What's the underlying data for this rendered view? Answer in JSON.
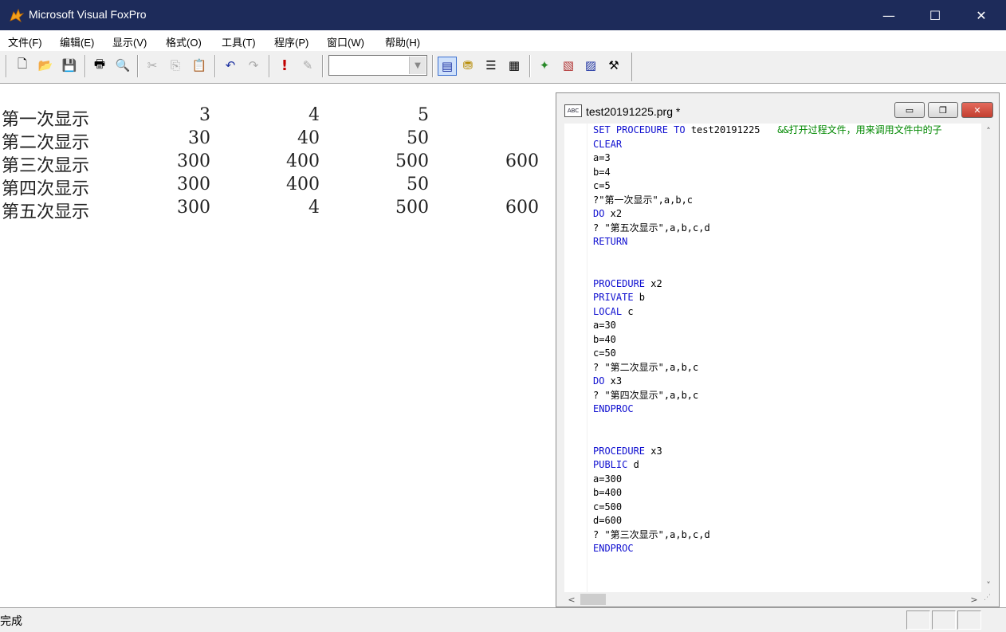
{
  "window": {
    "title": "Microsoft Visual FoxPro",
    "minimize_glyph": "—",
    "maximize_glyph": "☐",
    "close_glyph": "✕"
  },
  "menu": [
    {
      "label": "文件(F)"
    },
    {
      "label": "编辑(E)"
    },
    {
      "label": "显示(V)"
    },
    {
      "label": "格式(O)"
    },
    {
      "label": "工具(T)"
    },
    {
      "label": "程序(P)"
    },
    {
      "label": "窗口(W)"
    },
    {
      "label": "帮助(H)"
    }
  ],
  "toolbar": {
    "buttons": [
      {
        "icon": "new-file-icon",
        "glyph": "🗋",
        "enabled": true
      },
      {
        "icon": "open-folder-icon",
        "glyph": "📂",
        "enabled": true
      },
      {
        "icon": "save-icon",
        "glyph": "💾",
        "enabled": true
      },
      {
        "icon": "print-icon",
        "glyph": "🖶",
        "enabled": true
      },
      {
        "icon": "print-preview-icon",
        "glyph": "🔍",
        "enabled": false
      },
      {
        "icon": "cut-icon",
        "glyph": "✂",
        "enabled": false
      },
      {
        "icon": "copy-icon",
        "glyph": "⎘",
        "enabled": false
      },
      {
        "icon": "paste-icon",
        "glyph": "📋",
        "enabled": true
      },
      {
        "icon": "undo-icon",
        "glyph": "↶",
        "enabled": true
      },
      {
        "icon": "redo-icon",
        "glyph": "↷",
        "enabled": false
      },
      {
        "icon": "run-icon",
        "glyph": "!",
        "enabled": true
      },
      {
        "icon": "modify-form-icon",
        "glyph": "✎",
        "enabled": false
      },
      {
        "icon": "command-window-icon",
        "glyph": "▤",
        "enabled": true
      },
      {
        "icon": "data-session-icon",
        "glyph": "⛃",
        "enabled": true
      },
      {
        "icon": "properties-icon",
        "glyph": "☰",
        "enabled": true
      },
      {
        "icon": "code-window-icon",
        "glyph": "▦",
        "enabled": true
      },
      {
        "icon": "form-wizard-icon",
        "glyph": "✦",
        "enabled": true
      },
      {
        "icon": "autoformat-icon",
        "glyph": "▧",
        "enabled": true
      },
      {
        "icon": "report-designer-icon",
        "glyph": "▨",
        "enabled": true
      },
      {
        "icon": "tools-icon",
        "glyph": "⚒",
        "enabled": true
      }
    ],
    "combo_value": "",
    "combo_arrow": "▼"
  },
  "output": [
    {
      "label": "第一次显示",
      "values": [
        "3",
        "4",
        "5",
        ""
      ]
    },
    {
      "label": "第二次显示",
      "values": [
        "30",
        "40",
        "50",
        ""
      ]
    },
    {
      "label": "第三次显示",
      "values": [
        "300",
        "400",
        "500",
        "600"
      ]
    },
    {
      "label": "第四次显示",
      "values": [
        "300",
        "400",
        "50",
        ""
      ]
    },
    {
      "label": "第五次显示",
      "values": [
        "300",
        "4",
        "500",
        "600"
      ]
    }
  ],
  "editor": {
    "title": "test20191225.prg *",
    "icon_text": "ABC",
    "min_glyph": "▭",
    "max_glyph": "❐",
    "close_glyph": "✕",
    "lines": [
      {
        "kw": "SET PROCEDURE TO",
        "text": " test20191225   ",
        "cm": "&&打开过程文件，用来调用文件中的子"
      },
      {
        "kw": "CLEAR",
        "text": "",
        "cm": ""
      },
      {
        "kw": "",
        "text": "a=3",
        "cm": ""
      },
      {
        "kw": "",
        "text": "b=4",
        "cm": ""
      },
      {
        "kw": "",
        "text": "c=5",
        "cm": ""
      },
      {
        "kw": "",
        "text": "?\"第一次显示\",a,b,c",
        "cm": ""
      },
      {
        "kw": "DO",
        "text": " x2",
        "cm": ""
      },
      {
        "kw": "",
        "text": "? \"第五次显示\",a,b,c,d",
        "cm": ""
      },
      {
        "kw": "RETURN",
        "text": "",
        "cm": ""
      },
      {
        "kw": "",
        "text": "",
        "cm": ""
      },
      {
        "kw": "",
        "text": "",
        "cm": ""
      },
      {
        "kw": "PROCEDURE",
        "text": " x2",
        "cm": ""
      },
      {
        "kw": "PRIVATE",
        "text": " b",
        "cm": ""
      },
      {
        "kw": "LOCAL",
        "text": " c",
        "cm": ""
      },
      {
        "kw": "",
        "text": "a=30",
        "cm": ""
      },
      {
        "kw": "",
        "text": "b=40",
        "cm": ""
      },
      {
        "kw": "",
        "text": "c=50",
        "cm": ""
      },
      {
        "kw": "",
        "text": "? \"第二次显示\",a,b,c",
        "cm": ""
      },
      {
        "kw": "DO",
        "text": " x3",
        "cm": ""
      },
      {
        "kw": "",
        "text": "? \"第四次显示\",a,b,c",
        "cm": ""
      },
      {
        "kw": "ENDPROC",
        "text": "",
        "cm": ""
      },
      {
        "kw": "",
        "text": "",
        "cm": ""
      },
      {
        "kw": "",
        "text": "",
        "cm": ""
      },
      {
        "kw": "PROCEDURE",
        "text": " x3",
        "cm": ""
      },
      {
        "kw": "PUBLIC",
        "text": " d",
        "cm": ""
      },
      {
        "kw": "",
        "text": "a=300",
        "cm": ""
      },
      {
        "kw": "",
        "text": "b=400",
        "cm": ""
      },
      {
        "kw": "",
        "text": "c=500",
        "cm": ""
      },
      {
        "kw": "",
        "text": "d=600",
        "cm": ""
      },
      {
        "kw": "",
        "text": "? \"第三次显示\",a,b,c,d",
        "cm": ""
      },
      {
        "kw": "ENDPROC",
        "text": "",
        "cm": ""
      }
    ],
    "scroll_up": "˄",
    "scroll_down": "˅",
    "scroll_left": "<",
    "scroll_right": ">"
  },
  "status": {
    "text": "完成"
  },
  "colors": {
    "titlebar": "#1d2b5a",
    "keyword": "#1010d0",
    "comment": "#008800"
  }
}
